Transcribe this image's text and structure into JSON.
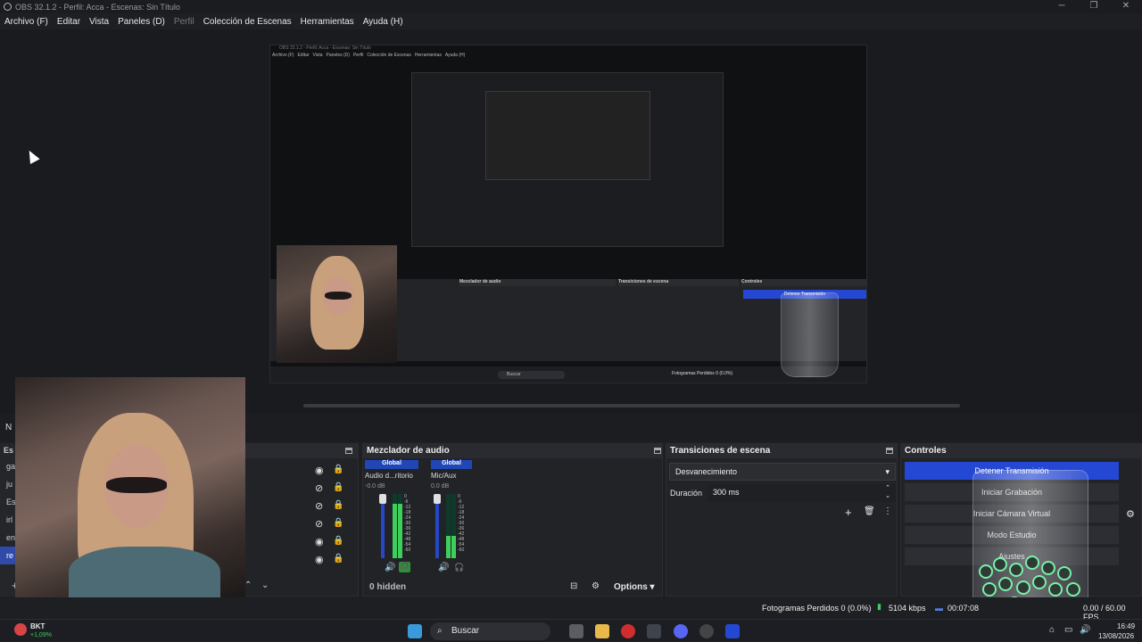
{
  "window": {
    "title": "OBS 32.1.2 - Perfil: Acca - Escenas: Sin Título"
  },
  "menu": {
    "items": [
      "Archivo (F)",
      "Editar",
      "Vista",
      "Paneles (D)",
      "Perfil",
      "Colección de Escenas",
      "Herramientas",
      "Ayuda (H)"
    ]
  },
  "preview_mini": {
    "title": "OBS 32.1.2 - Perfil: Acca - Escenas: Sin Título",
    "menu": [
      "Archivo (F)",
      "Editar",
      "Vista",
      "Paneles (D)",
      "Perfil",
      "Colección de Escenas",
      "Herramientas",
      "Ayuda (H)"
    ],
    "mixer": "Mezclador de audio",
    "transitions": "Transiciones de escena",
    "controls": "Controles",
    "stop": "Detener Transmisión",
    "search": "Buscar",
    "status": "Fotogramas Perdidos 0 (0.0%)"
  },
  "scene_strip": {
    "label": "N"
  },
  "scenes": {
    "header": "Es",
    "items": [
      "ga",
      "ju",
      "Es",
      "irl",
      "en",
      "re"
    ],
    "selected_index": 5
  },
  "sources": {
    "rows": 7
  },
  "mixer": {
    "header": "Mezclador de audio",
    "buses": [
      {
        "global": "Global",
        "name": "Audio d...ritorio",
        "db": "-0.0 dB",
        "level": 0.85
      },
      {
        "global": "Global",
        "name": "Mic/Aux",
        "db": "0.0 dB",
        "level": 0.35
      }
    ],
    "scale": [
      "0",
      "-6",
      "-12",
      "-18",
      "-24",
      "-30",
      "-36",
      "-42",
      "-48",
      "-54",
      "-60"
    ],
    "hidden": "0 hidden",
    "options": "Options"
  },
  "transitions": {
    "header": "Transiciones de escena",
    "selected": "Desvanecimiento",
    "duration_label": "Duración",
    "duration_value": "300 ms"
  },
  "controls": {
    "header": "Controles",
    "buttons": [
      "Detener Transmisión",
      "Iniciar Grabación",
      "Iniciar Cámara Virtual",
      "Modo Estudio",
      "Ajustes"
    ]
  },
  "status": {
    "dropped": "Fotogramas Perdidos 0 (0.0%)",
    "bitrate": "5104 kbps",
    "time": "00:07:08",
    "fps": "0.00 / 60.00 FPS"
  },
  "taskbar": {
    "app_name": "BKT",
    "app_change": "+1,09%",
    "search": "Buscar",
    "clock_time": "16:49",
    "clock_date": "13/08/2026",
    "accent": "#2548d4"
  }
}
